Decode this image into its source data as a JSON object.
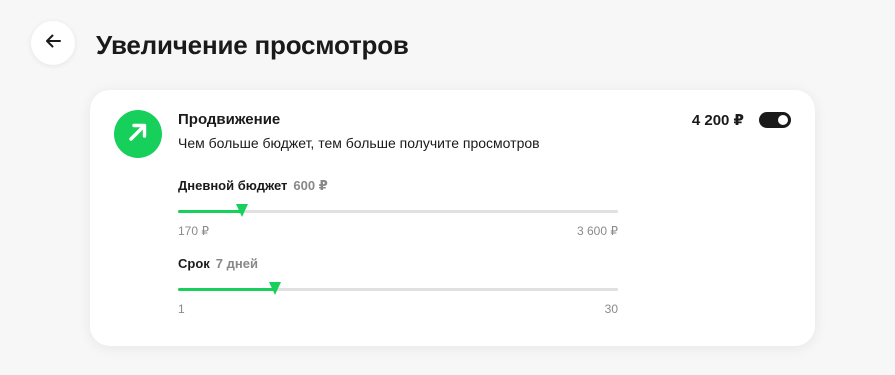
{
  "colors": {
    "accent": "#17d05c",
    "dark": "#1a1a1a"
  },
  "header": {
    "back_icon": "arrow-left-icon",
    "title": "Увеличение просмотров"
  },
  "promotion": {
    "icon": "arrow-up-right-icon",
    "title": "Продвижение",
    "description": "Чем больше бюджет, тем больше получите просмотров",
    "price": "4 200 ₽",
    "enabled": true
  },
  "budget": {
    "label": "Дневной бюджет",
    "value": "600 ₽",
    "min_label": "170 ₽",
    "max_label": "3 600 ₽",
    "level": 0.145
  },
  "duration": {
    "label": "Срок",
    "value": "7 дней",
    "min_label": "1",
    "max_label": "30",
    "level": 0.22
  }
}
